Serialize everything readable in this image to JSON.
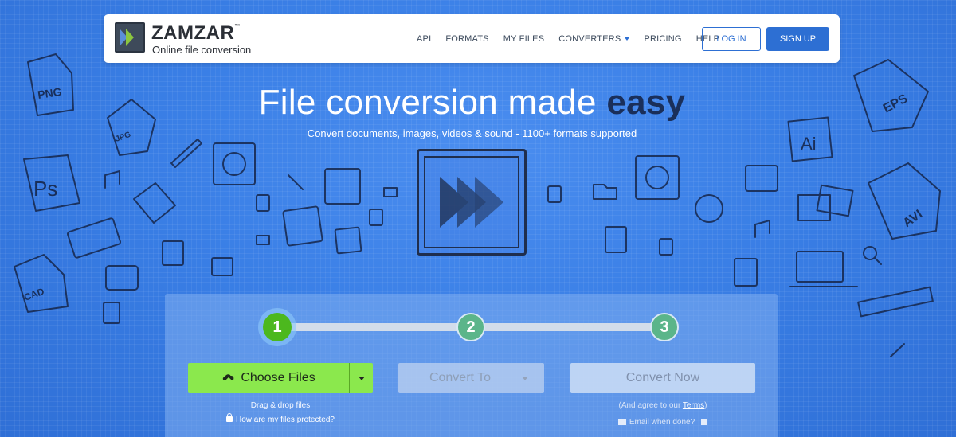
{
  "header": {
    "logo": {
      "name": "ZAMZAR",
      "tm": "™",
      "tagline": "Online file conversion",
      "icon": "zamzar-logo-icon"
    },
    "nav": [
      {
        "label": "API"
      },
      {
        "label": "FORMATS"
      },
      {
        "label": "MY FILES"
      },
      {
        "label": "CONVERTERS",
        "icon": "chevron-down-icon"
      },
      {
        "label": "PRICING"
      },
      {
        "label": "HELP"
      }
    ],
    "login_label": "LOG IN",
    "signup_label": "SIGN UP"
  },
  "hero": {
    "title_regular": "File conversion made ",
    "title_bold": "easy",
    "subtitle": "Convert documents, images, videos & sound - 1100+ formats supported"
  },
  "doodle_labels": [
    "PNG",
    "JPG",
    "Ps",
    "CAD",
    "EPS",
    "Ai",
    "AVI"
  ],
  "converter": {
    "steps": [
      "1",
      "2",
      "3"
    ],
    "active_step": 1,
    "choose_files_label": "Choose Files",
    "convert_to_label": "Convert To",
    "convert_now_label": "Convert Now",
    "drag_drop": "Drag & drop files",
    "protected_link": "How are my files protected?",
    "agree_prefix": "(And agree to our ",
    "agree_link": "Terms",
    "agree_suffix": ")",
    "email_label": "Email when done?"
  },
  "colors": {
    "background": "#3a7fe6",
    "accent": "#2d6fd3",
    "active_green": "#4cb81e",
    "choose_green": "#8be84d",
    "title_dark": "#1a2f5a"
  }
}
